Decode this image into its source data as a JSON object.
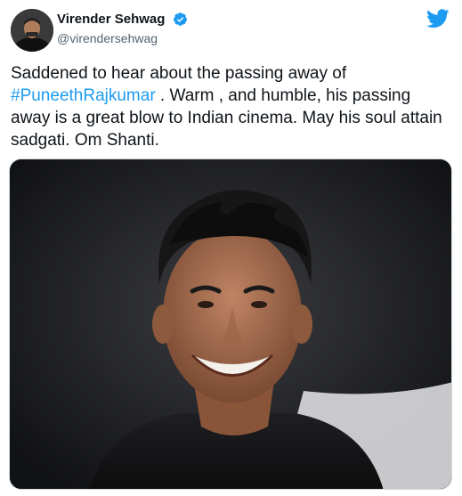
{
  "tweet": {
    "author": {
      "display_name": "Virender Sehwag",
      "handle": "@virendersehwag",
      "verified": true
    },
    "text_before": "Saddened to hear about the passing away of ",
    "hashtag": "#PuneethRajkumar",
    "text_after": " . Warm , and humble, his passing away is a great blow to Indian cinema. May his soul attain sadgati. Om Shanti.",
    "media": {
      "type": "photo",
      "subject": "portrait of a smiling man"
    }
  },
  "colors": {
    "link": "#1d9bf0",
    "verified_badge": "#1d9bf0",
    "twitter_brand": "#1d9bf0",
    "text": "#0f1419",
    "secondary_text": "#536471"
  },
  "icons": {
    "verified": "verified-badge-icon",
    "brand": "twitter-bird-icon"
  }
}
